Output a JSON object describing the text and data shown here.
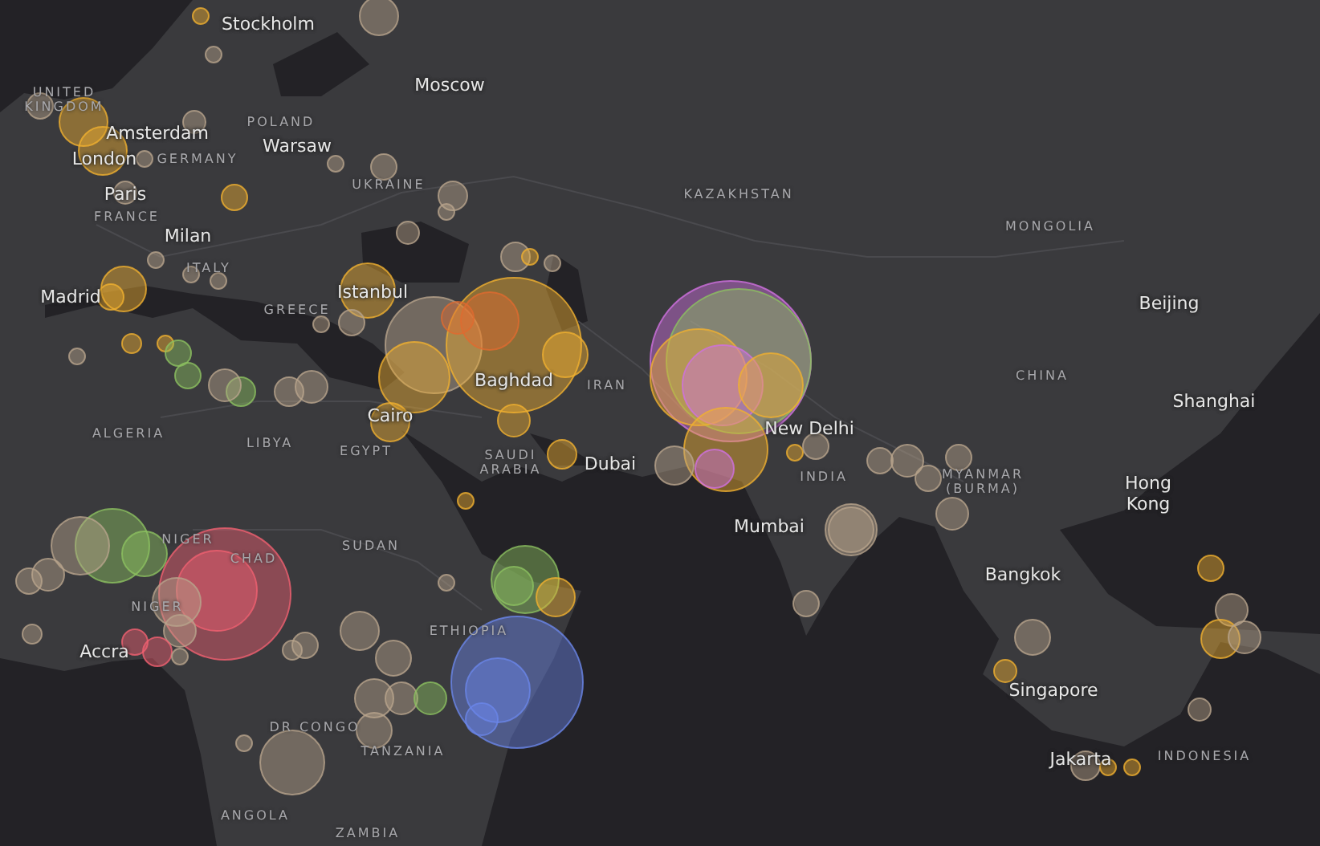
{
  "map": {
    "cities": [
      {
        "name": "Stockholm"
      },
      {
        "name": "Moscow"
      },
      {
        "name": "Amsterdam"
      },
      {
        "name": "Warsaw"
      },
      {
        "name": "London"
      },
      {
        "name": "Paris"
      },
      {
        "name": "Milan"
      },
      {
        "name": "Istanbul"
      },
      {
        "name": "Madrid"
      },
      {
        "name": "Baghdad"
      },
      {
        "name": "Cairo"
      },
      {
        "name": "Dubai"
      },
      {
        "name": "New Delhi"
      },
      {
        "name": "Mumbai"
      },
      {
        "name": "Beijing"
      },
      {
        "name": "Shanghai"
      },
      {
        "name": "Hong Kong"
      },
      {
        "name": "Bangkok"
      },
      {
        "name": "Singapore"
      },
      {
        "name": "Jakarta"
      },
      {
        "name": "Accra"
      }
    ],
    "countries": [
      {
        "name": "UNITED KINGDOM"
      },
      {
        "name": "POLAND"
      },
      {
        "name": "GERMANY"
      },
      {
        "name": "UKRAINE"
      },
      {
        "name": "FRANCE"
      },
      {
        "name": "ITALY"
      },
      {
        "name": "GREECE"
      },
      {
        "name": "KAZAKHSTAN"
      },
      {
        "name": "MONGOLIA"
      },
      {
        "name": "CHINA"
      },
      {
        "name": "IRAN"
      },
      {
        "name": "ALGERIA"
      },
      {
        "name": "LIBYA"
      },
      {
        "name": "EGYPT"
      },
      {
        "name": "SAUDI ARABIA"
      },
      {
        "name": "INDIA"
      },
      {
        "name": "MYANMAR (BURMA)"
      },
      {
        "name": "NIGER"
      },
      {
        "name": "CHAD"
      },
      {
        "name": "SUDAN"
      },
      {
        "name": "NIGER"
      },
      {
        "name": "ETHIOPIA"
      },
      {
        "name": "DR CONGO"
      },
      {
        "name": "TANZANIA"
      },
      {
        "name": "ANGOLA"
      },
      {
        "name": "ZAMBIA"
      },
      {
        "name": "INDONESIA"
      }
    ]
  }
}
